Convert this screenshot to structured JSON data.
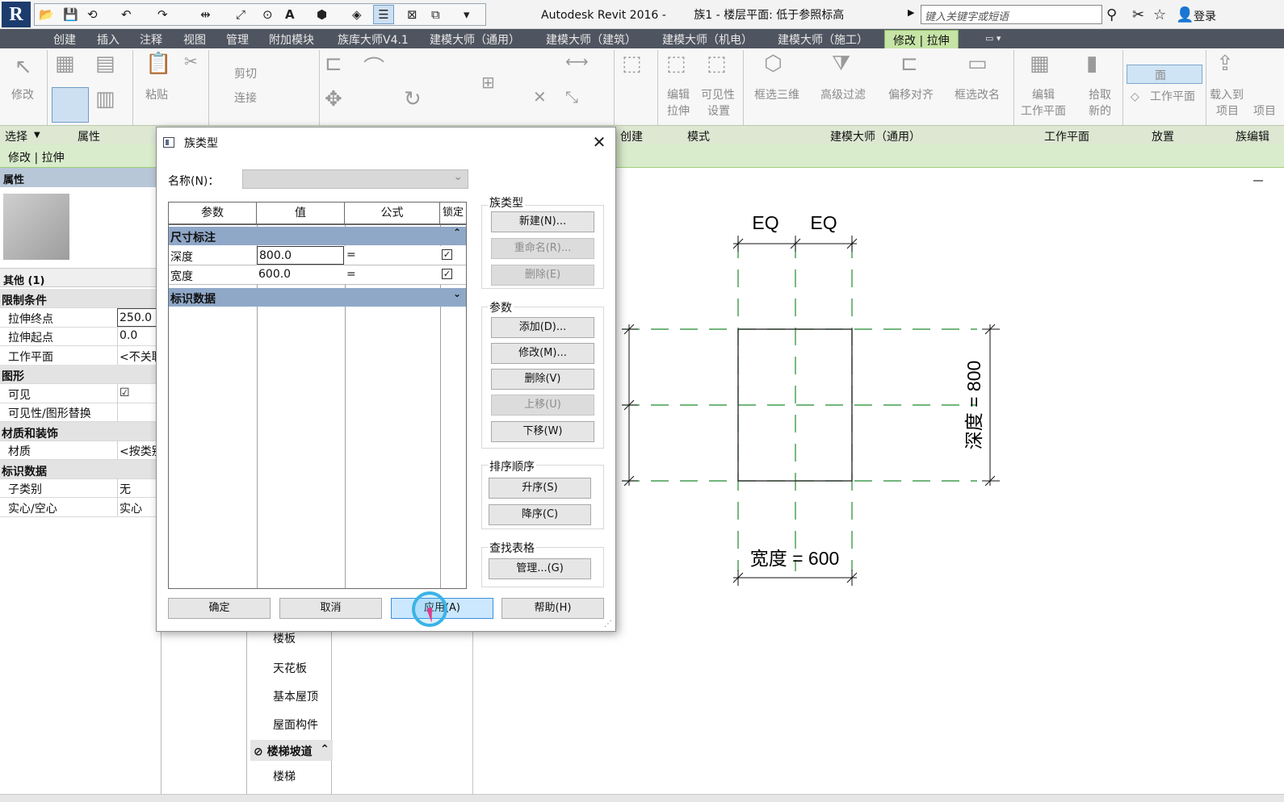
{
  "titlebar": {
    "app_title": "Autodesk Revit 2016 -",
    "document": "族1 - 楼层平面: 低于参照标高",
    "search_placeholder": "键入关键字或短语",
    "login": "登录"
  },
  "tabs": [
    "创建",
    "插入",
    "注释",
    "视图",
    "管理",
    "附加模块",
    "族库大师V4.1",
    "建模大师（通用）",
    "建模大师（建筑）",
    "建模大师（机电）",
    "建模大师（施工）",
    "修改 | 拉伸"
  ],
  "ribbon": {
    "panels": [
      "选择",
      "属性",
      "创建",
      "模式",
      "建模大师（通用）",
      "工作平面",
      "放置",
      "族编辑"
    ],
    "buttons": {
      "modify": "修改",
      "paste": "粘贴",
      "cut": "剪切",
      "join": "连接",
      "edit_extrusion_1": "编辑",
      "edit_extrusion_2": "拉伸",
      "visibility_1": "可见性",
      "visibility_2": "设置",
      "box_3d": "框选三维",
      "adv_filter": "高级过滤",
      "offset_align": "偏移对齐",
      "box_rename": "框选改名",
      "edit_wp_1": "编辑",
      "edit_wp_2": "工作平面",
      "pick_new_1": "拾取",
      "pick_new_2": "新的",
      "face": "面",
      "work_plane": "工作平面",
      "load_into_1": "载入到",
      "load_into_2": "项目",
      "load_into_3": "项目"
    }
  },
  "context": "修改 | 拉伸",
  "properties": {
    "title": "属性",
    "selector": "其他 (1)",
    "rows": [
      {
        "type": "cat",
        "name": "限制条件"
      },
      {
        "type": "row",
        "name": "拉伸终点",
        "value": "250.0",
        "edit": true
      },
      {
        "type": "row",
        "name": "拉伸起点",
        "value": "0.0"
      },
      {
        "type": "row",
        "name": "工作平面",
        "value": "<不关联>"
      },
      {
        "type": "cat",
        "name": "图形"
      },
      {
        "type": "row",
        "name": "可见",
        "value": "☑"
      },
      {
        "type": "row",
        "name": "可见性/图形替换",
        "value": ""
      },
      {
        "type": "cat",
        "name": "材质和装饰"
      },
      {
        "type": "row",
        "name": "材质",
        "value": "<按类别>"
      },
      {
        "type": "cat",
        "name": "标识数据"
      },
      {
        "type": "row",
        "name": "子类别",
        "value": "无"
      },
      {
        "type": "row",
        "name": "实心/空心",
        "value": "实心"
      }
    ]
  },
  "browser": {
    "items": [
      "楼板",
      "天花板",
      "基本屋顶",
      "屋面构件"
    ],
    "category": "楼梯坡道",
    "sub_item": "楼梯"
  },
  "drawing": {
    "eq_left": "EQ",
    "eq_right": "EQ",
    "depth_label": "深度 = 800",
    "width_label": "宽度 = 600",
    "line_color": "#1f8a2e"
  },
  "dialog": {
    "title": "族类型",
    "name_label": "名称(N)：",
    "columns": [
      "参数",
      "值",
      "公式",
      "锁定"
    ],
    "groups": [
      {
        "name": "尺寸标注",
        "chevron": "⌃"
      },
      {
        "name": "标识数据",
        "chevron": "⌄"
      }
    ],
    "params": [
      {
        "name": "深度",
        "value": "800.0",
        "formula": "=",
        "locked": "✓",
        "edit": true
      },
      {
        "name": "宽度",
        "value": "600.0",
        "formula": "=",
        "locked": "✓"
      }
    ],
    "family_types_group": "族类型",
    "new_btn": "新建(N)...",
    "rename_btn": "重命名(R)...",
    "delete_type_btn": "删除(E)",
    "params_group": "参数",
    "add_btn": "添加(D)...",
    "modify_btn": "修改(M)...",
    "delete_param_btn": "删除(V)",
    "move_up_btn": "上移(U)",
    "move_down_btn": "下移(W)",
    "sort_group": "排序顺序",
    "asc_btn": "升序(S)",
    "desc_btn": "降序(C)",
    "lookup_group": "查找表格",
    "manage_btn": "管理...(G)",
    "ok_btn": "确定",
    "cancel_btn": "取消",
    "apply_btn": "应用(A)",
    "help_btn": "帮助(H)"
  }
}
